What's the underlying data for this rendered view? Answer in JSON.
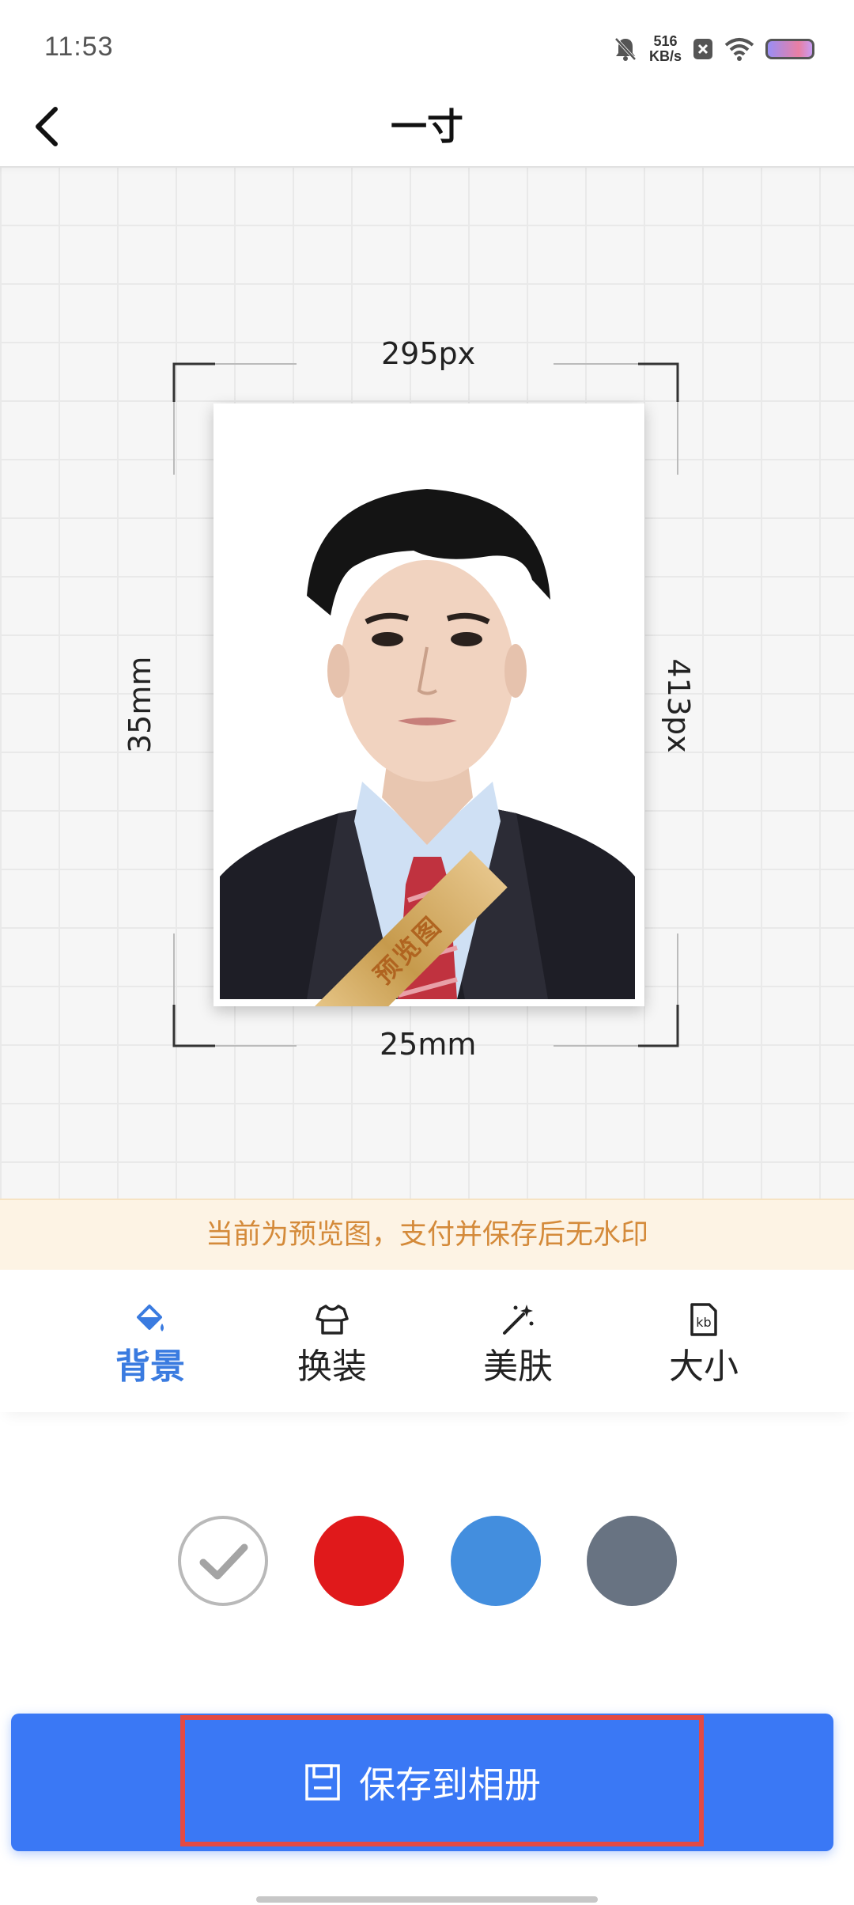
{
  "status_bar": {
    "time": "11:53",
    "net_speed_value": "516",
    "net_speed_unit": "KB/s",
    "icons": [
      "mute-bell-icon",
      "notification-x-icon",
      "wifi-icon",
      "battery-icon"
    ]
  },
  "header": {
    "title": "一寸",
    "back_icon": "chevron-left-icon"
  },
  "preview": {
    "top_label": "295px",
    "bottom_label": "25mm",
    "left_label": "35mm",
    "right_label": "413px",
    "ribbon_text": "预览图"
  },
  "notice": {
    "text": "当前为预览图，支付并保存后无水印"
  },
  "tabs": [
    {
      "label": "背景",
      "icon": "paint-bucket-icon",
      "active": true
    },
    {
      "label": "换装",
      "icon": "shirt-icon",
      "active": false
    },
    {
      "label": "美肤",
      "icon": "magic-wand-icon",
      "active": false
    },
    {
      "label": "大小",
      "icon": "file-size-kb-icon",
      "active": false
    }
  ],
  "colors": {
    "accent": "#3a78f5",
    "tab_active": "#3a7be0",
    "notice_text": "#d48a3a",
    "swatch_white": "#ffffff",
    "swatch_red": "#e0191b",
    "swatch_blue": "#438ede",
    "swatch_gray": "#687382"
  },
  "background_swatches": [
    {
      "name": "white",
      "selected": true
    },
    {
      "name": "red",
      "selected": false
    },
    {
      "name": "blue",
      "selected": false
    },
    {
      "name": "gray",
      "selected": false
    }
  ],
  "save_button": {
    "label": "保存到相册",
    "icon": "save-floppy-icon"
  }
}
